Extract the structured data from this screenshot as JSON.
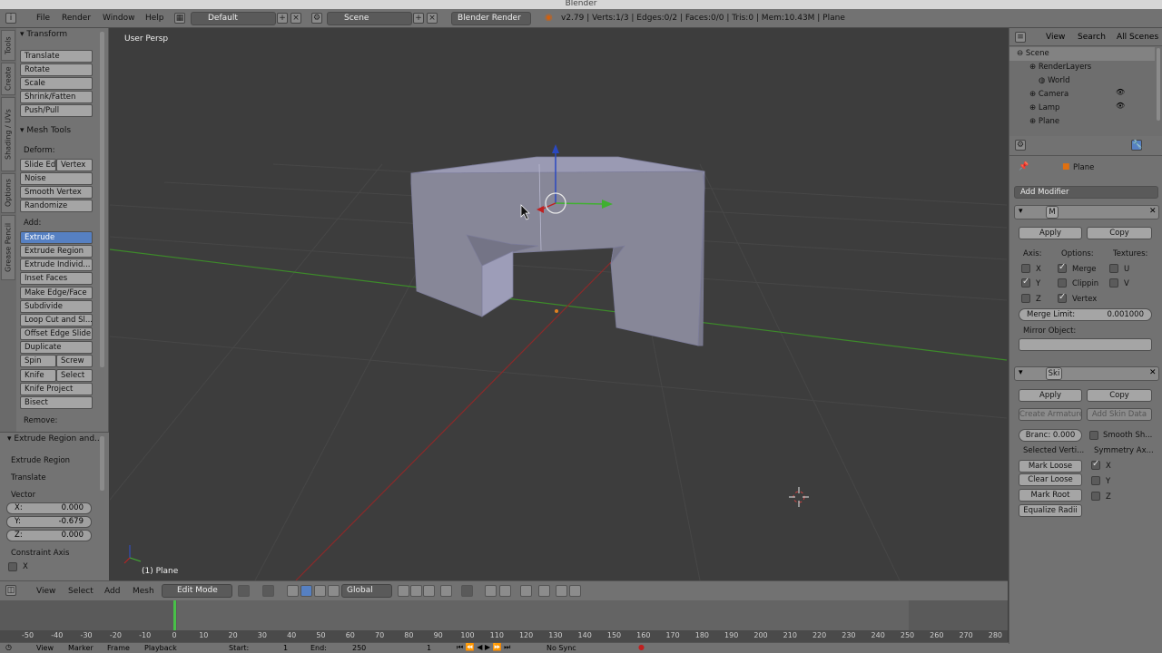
{
  "window": {
    "title": "Blender"
  },
  "menubar": {
    "menus": [
      "File",
      "Render",
      "Window",
      "Help"
    ],
    "layout": "Default",
    "scene": "Scene",
    "engine": "Blender Render",
    "stats": "v2.79 | Verts:1/3 | Edges:0/2 | Faces:0/0 | Tris:0 | Mem:10.43M | Plane"
  },
  "toolshelf": {
    "tabs": [
      "Tools",
      "Create",
      "Shading / UVs",
      "Options",
      "Grease Pencil"
    ],
    "transform": {
      "title": "Transform",
      "buttons": [
        "Translate",
        "Rotate",
        "Scale",
        "Shrink/Fatten",
        "Push/Pull"
      ]
    },
    "mesh_tools": {
      "title": "Mesh Tools",
      "deform_label": "Deform:",
      "slide_edge": "Slide Ed",
      "vertex": "Vertex",
      "deform_buttons": [
        "Noise",
        "Smooth Vertex",
        "Randomize"
      ],
      "add_label": "Add:",
      "extrude": "Extrude",
      "add_buttons": [
        "Extrude Region",
        "Extrude Individ...",
        "Inset Faces",
        "Make Edge/Face",
        "Subdivide",
        "Loop Cut and Sl...",
        "Offset Edge Slide",
        "Duplicate"
      ],
      "spin": "Spin",
      "screw": "Screw",
      "knife": "Knife",
      "select": "Select",
      "more_buttons": [
        "Knife Project",
        "Bisect"
      ],
      "remove_label": "Remove:"
    }
  },
  "redo_panel": {
    "title": "Extrude Region and...",
    "op1": "Extrude Region",
    "op2": "Translate",
    "vector_label": "Vector",
    "x_label": "X:",
    "x": "0.000",
    "y_label": "Y:",
    "y": "-0.679",
    "z_label": "Z:",
    "z": "0.000",
    "constraint_label": "Constraint Axis",
    "cx": "X"
  },
  "viewport": {
    "label": "User Persp",
    "object_label": "(1) Plane"
  },
  "viewport_header": {
    "menus": [
      "View",
      "Select",
      "Add",
      "Mesh"
    ],
    "mode": "Edit Mode",
    "orientation": "Global"
  },
  "timeline": {
    "ticks": [
      "-50",
      "-40",
      "-30",
      "-20",
      "-10",
      "0",
      "10",
      "20",
      "30",
      "40",
      "50",
      "60",
      "70",
      "80",
      "90",
      "100",
      "110",
      "120",
      "130",
      "140",
      "150",
      "160",
      "170",
      "180",
      "190",
      "200",
      "210",
      "220",
      "230",
      "240",
      "250",
      "260",
      "270",
      "280"
    ],
    "current_frame": 0,
    "menus": [
      "View",
      "Marker",
      "Frame",
      "Playback"
    ],
    "start_label": "Start:",
    "start": "1",
    "end_label": "End:",
    "end": "250",
    "frame": "1",
    "sync": "No Sync"
  },
  "outliner": {
    "menus": [
      "View",
      "Search"
    ],
    "scope": "All Scenes",
    "items": [
      "Scene",
      "RenderLayers",
      "World",
      "Camera",
      "Lamp",
      "Plane"
    ]
  },
  "properties": {
    "object": "Plane",
    "add_modifier": "Add Modifier",
    "mirror": {
      "name": "M",
      "apply": "Apply",
      "copy": "Copy",
      "axis_label": "Axis:",
      "options_label": "Options:",
      "textures_label": "Textures:",
      "x": "X",
      "y": "Y",
      "z": "Z",
      "merge": "Merge",
      "clipping": "Clippin",
      "vertex": "Vertex",
      "u": "U",
      "v": "V",
      "merge_limit_label": "Merge Limit:",
      "merge_limit": "0.001000",
      "mirror_object_label": "Mirror Object:"
    },
    "skin": {
      "name": "Ski",
      "apply": "Apply",
      "copy": "Copy",
      "create_armature": "Create Armature",
      "add_skin_data": "Add Skin Data",
      "branch": "Branc: 0.000",
      "smooth_shading": "Smooth Sh...",
      "selected_label": "Selected Verti...",
      "symmetry_label": "Symmetry Ax...",
      "mark_loose": "Mark Loose",
      "clear_loose": "Clear Loose",
      "mark_root": "Mark Root",
      "equalize": "Equalize Radii",
      "sx": "X",
      "sy": "Y",
      "sz": "Z"
    }
  },
  "colors": {
    "accent": "#5680c2",
    "x_axis": "#c03030",
    "y_axis": "#60b040",
    "z_axis": "#3050d0"
  }
}
